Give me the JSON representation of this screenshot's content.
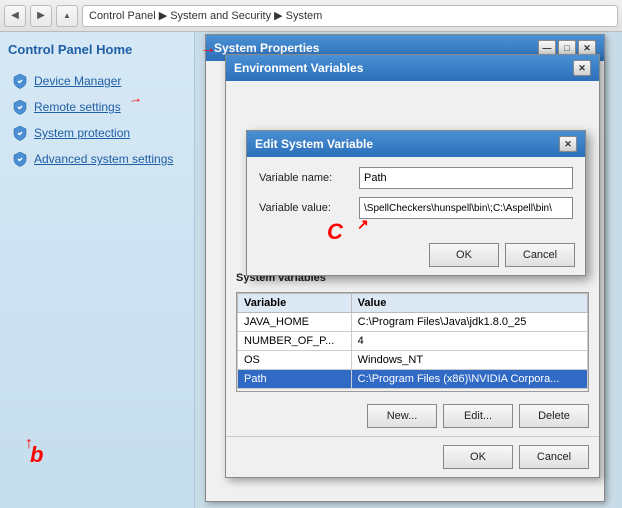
{
  "nav": {
    "back_btn": "◀",
    "forward_btn": "▶",
    "up_btn": "▲",
    "breadcrumb": "Control Panel ▶ System and Security ▶ System"
  },
  "sidebar": {
    "title": "Control Panel Home",
    "items": [
      {
        "label": "Device Manager",
        "icon": "shield"
      },
      {
        "label": "Remote settings",
        "icon": "shield"
      },
      {
        "label": "System protection",
        "icon": "shield"
      },
      {
        "label": "Advanced system settings",
        "icon": "shield"
      }
    ]
  },
  "system_properties": {
    "title": "System Properties",
    "close_btn": "✕"
  },
  "env_vars": {
    "title": "Environment Variables",
    "close_btn": "✕",
    "system_vars_label": "System variables",
    "table_headers": [
      "Variable",
      "Value"
    ],
    "table_rows": [
      {
        "variable": "JAVA_HOME",
        "value": "C:\\Program Files\\Java\\jdk1.8.0_25"
      },
      {
        "variable": "NUMBER_OF_P...",
        "value": "4"
      },
      {
        "variable": "OS",
        "value": "Windows_NT"
      },
      {
        "variable": "Path",
        "value": "C:\\Program Files (x86)\\NVIDIA Corpora..."
      }
    ],
    "new_btn": "New...",
    "edit_btn": "Edit...",
    "delete_btn": "Delete",
    "ok_btn": "OK",
    "cancel_btn": "Cancel"
  },
  "edit_var": {
    "title": "Edit System Variable",
    "close_btn": "✕",
    "variable_name_label": "Variable name:",
    "variable_name_value": "Path",
    "variable_value_label": "Variable value:",
    "variable_value_value": "\\SpellCheckers\\hunspell\\bin\\;C:\\Aspell\\bin\\",
    "ok_btn": "OK",
    "cancel_btn": "Cancel"
  },
  "annotations": {
    "a_label": "→",
    "b_label": "b",
    "c_label": "C"
  }
}
